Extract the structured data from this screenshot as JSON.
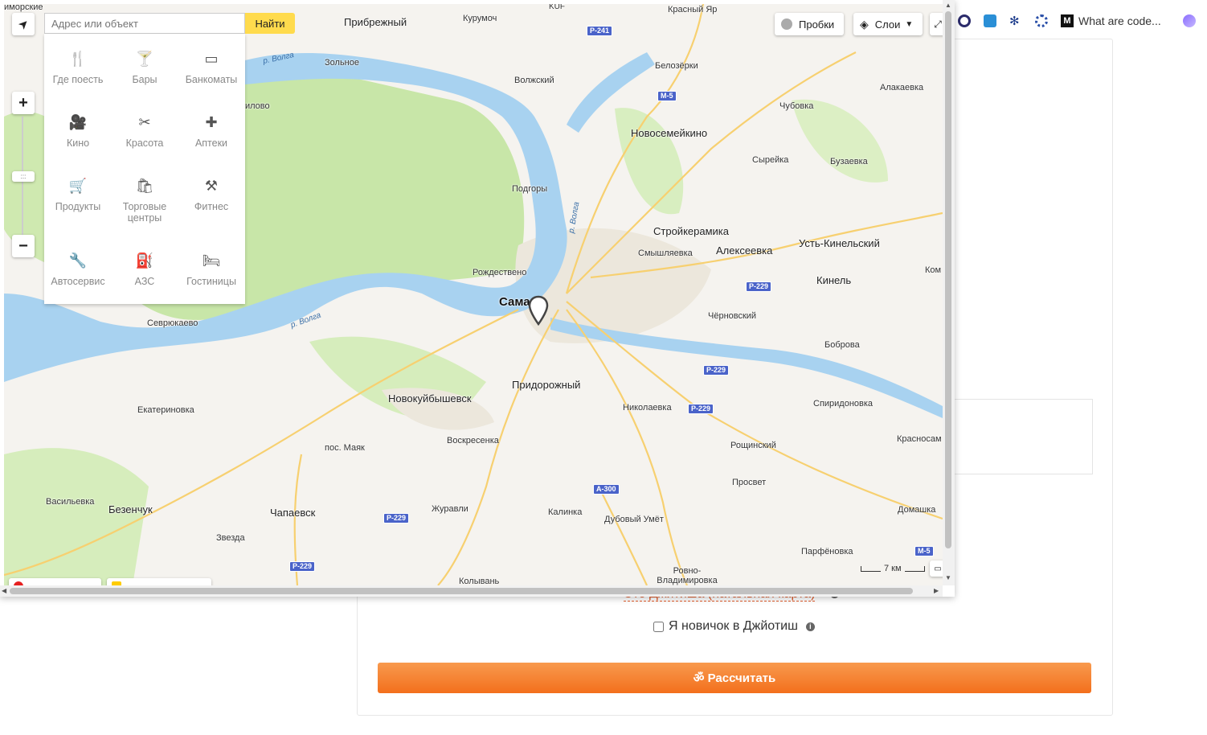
{
  "bookmarks": {
    "tab_title": "What are code..."
  },
  "map": {
    "search": {
      "placeholder": "Адрес или объект",
      "button": "Найти"
    },
    "controls": {
      "traffic": "Пробки",
      "layers": "Слои",
      "zoom_in": "+",
      "zoom_out": "−",
      "handle": ":::"
    },
    "categories": [
      {
        "label": "Где поесть",
        "icon": "fork-knife-icon",
        "glyph": "🍴"
      },
      {
        "label": "Бары",
        "icon": "cocktail-icon",
        "glyph": "🍸"
      },
      {
        "label": "Банкоматы",
        "icon": "atm-card-icon",
        "glyph": "▭"
      },
      {
        "label": "Кино",
        "icon": "film-camera-icon",
        "glyph": "🎥"
      },
      {
        "label": "Красота",
        "icon": "scissors-icon",
        "glyph": "✂"
      },
      {
        "label": "Аптеки",
        "icon": "pharmacy-cross-icon",
        "glyph": "✚"
      },
      {
        "label": "Продукты",
        "icon": "shopping-cart-icon",
        "glyph": "🛒"
      },
      {
        "label": "Торговые центры",
        "icon": "shopping-bag-icon",
        "glyph": "🛍"
      },
      {
        "label": "Фитнес",
        "icon": "dumbbell-icon",
        "glyph": "⚒"
      },
      {
        "label": "Автосервис",
        "icon": "wrench-icon",
        "glyph": "🔧"
      },
      {
        "label": "АЗС",
        "icon": "fuel-pump-icon",
        "glyph": "⛽"
      },
      {
        "label": "Гостиницы",
        "icon": "bed-icon",
        "glyph": "🛏"
      }
    ],
    "scale": "7 км",
    "places": [
      "иморские",
      "Прибрежный",
      "Курумоч",
      "KUF",
      "Красный Яр",
      "Зольное",
      "Волжский",
      "Белозёрки",
      "Алакаевка",
      "Чубовка",
      "илово",
      "Новосемейкино",
      "Сырейка",
      "Бузаевка",
      "Подгоры",
      "Стройкерамика",
      "Смышляевка",
      "Алексеевка",
      "Усть-Кинельский",
      "Кинель",
      "Ком",
      "Рождествено",
      "Сама",
      "Чёрновский",
      "Севрюкаево",
      "Боброва",
      "Придорожный",
      "Новокуйбышевск",
      "Николаевка",
      "Спиридоновка",
      "Екатериновка",
      "Воскресенка",
      "пос. Маяк",
      "Рощинский",
      "Красносам",
      "Просвет",
      "Васильевка",
      "Безенчук",
      "Чапаевск",
      "Журавли",
      "Калинка",
      "Дубовый Умёт",
      "Домашка",
      "Звезда",
      "Парфёновка",
      "Ровно-Владимировка",
      "Колывань"
    ],
    "rivers": [
      "р. Волга",
      "р. Волга",
      "р. Волга"
    ],
    "roads": [
      "P-241",
      "M-5",
      "P-229",
      "P-229",
      "P-229",
      "A-300",
      "P-229",
      "P-229",
      "M-5"
    ]
  },
  "page": {
    "partial_link": "Это Джйтиша (натальная карта)",
    "novice_label": "Я новичок в Джйотиш",
    "novice_checked": false,
    "calculate_button": "ॐ Рассчитать"
  },
  "colors": {
    "water": "#a8d2f0",
    "forest": "#c8e6a8",
    "land": "#f5f3ef",
    "road": "#f7d070",
    "accent": "#f36f1c",
    "button_yellow": "#ffdb4d"
  }
}
